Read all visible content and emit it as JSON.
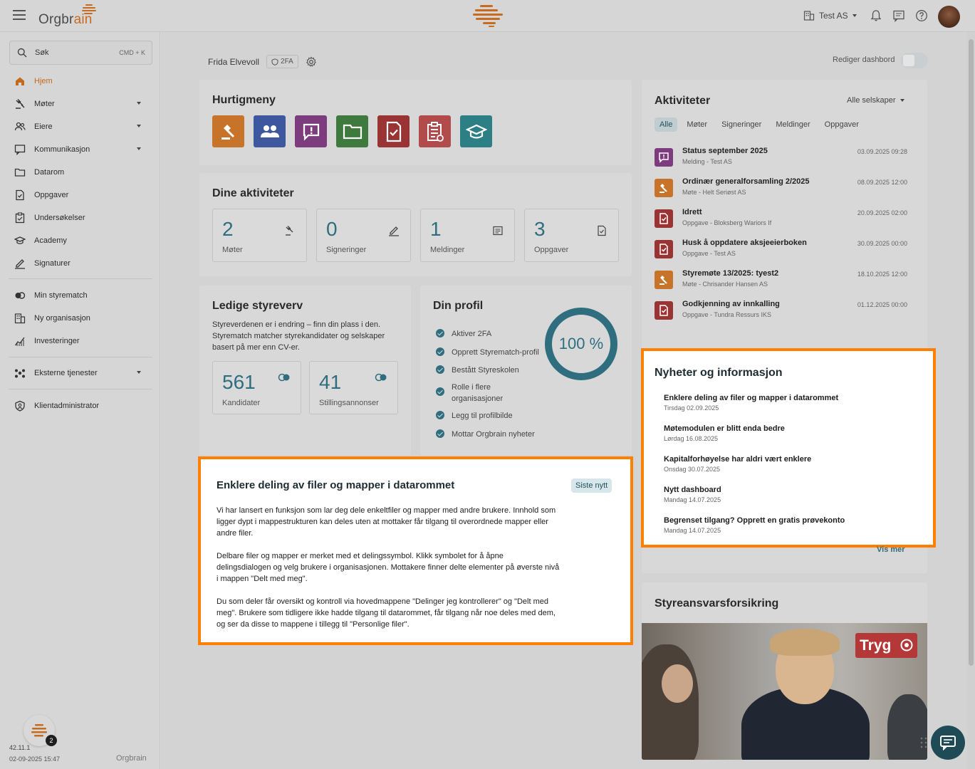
{
  "topbar": {
    "logo_text_a": "Orgbr",
    "logo_text_b": "ain",
    "company": "Test AS"
  },
  "sidebar": {
    "search_label": "Søk",
    "search_shortcut": "CMD + K",
    "items": [
      {
        "label": "Hjem",
        "icon": "home-icon",
        "active": true
      },
      {
        "label": "Møter",
        "icon": "gavel-icon"
      },
      {
        "label": "Eiere",
        "icon": "users-icon"
      },
      {
        "label": "Kommunikasjon",
        "icon": "message-icon"
      },
      {
        "label": "Datarom",
        "icon": "folder-icon"
      },
      {
        "label": "Oppgaver",
        "icon": "task-icon"
      },
      {
        "label": "Undersøkelser",
        "icon": "survey-icon"
      },
      {
        "label": "Academy",
        "icon": "graduation-icon"
      },
      {
        "label": "Signaturer",
        "icon": "signature-icon"
      },
      {
        "label": "Min styrematch",
        "icon": "match-icon"
      },
      {
        "label": "Ny organisasjon",
        "icon": "building-icon"
      },
      {
        "label": "Investeringer",
        "icon": "chart-icon"
      },
      {
        "label": "Eksterne tjenester",
        "icon": "network-icon"
      },
      {
        "label": "Klientadministrator",
        "icon": "admin-icon"
      }
    ],
    "notification_count": "2",
    "version": "42.11.1",
    "version_date": "02-09-2025 15:47",
    "footer_logo": "Orgbrain"
  },
  "header": {
    "user_name": "Frida Elvevoll",
    "twofa": "2FA",
    "edit_dashboard": "Rediger dashbord"
  },
  "quickmenu": {
    "title": "Hurtigmeny",
    "colors": [
      "#c8732a",
      "#3e58a0",
      "#7d3c7e",
      "#3e7a3d",
      "#9a3333",
      "#b24b4b",
      "#2c7f84"
    ]
  },
  "my_activities": {
    "title": "Dine aktiviteter",
    "stats": [
      {
        "value": "2",
        "label": "Møter"
      },
      {
        "value": "0",
        "label": "Signeringer"
      },
      {
        "value": "1",
        "label": "Meldinger"
      },
      {
        "value": "3",
        "label": "Oppgaver"
      }
    ]
  },
  "board": {
    "title": "Ledige styreverv",
    "text": "Styreverdenen er i endring – finn din plass i den. Styrematch matcher styrekandidater og selskaper basert på mer enn CV-er.",
    "stats": [
      {
        "value": "561",
        "label": "Kandidater"
      },
      {
        "value": "41",
        "label": "Stillingsannonser"
      }
    ]
  },
  "profile": {
    "title": "Din profil",
    "percent": "100 %",
    "items": [
      "Aktiver 2FA",
      "Opprett Styrematch-profil",
      "Bestått Styreskolen",
      "Rolle i flere organisasjoner",
      "Legg til profilbilde",
      "Mottar Orgbrain nyheter"
    ]
  },
  "activities": {
    "title": "Aktiviteter",
    "filter": "Alle selskaper",
    "tabs": [
      "Alle",
      "Møter",
      "Signeringer",
      "Meldinger",
      "Oppgaver"
    ],
    "items": [
      {
        "title": "Status september 2025",
        "sub": "Melding - Test AS",
        "date": "03.09.2025 09:28",
        "color": "#7d3c7e"
      },
      {
        "title": "Ordinær generalforsamling 2/2025",
        "sub": "Møte - Helt Seriøst AS",
        "date": "08.09.2025 12:00",
        "color": "#c8732a"
      },
      {
        "title": "Idrett",
        "sub": "Oppgave - Bloksberg Wariors If",
        "date": "20.09.2025 02:00",
        "color": "#9a3333"
      },
      {
        "title": "Husk å oppdatere aksjeeierboken",
        "sub": "Oppgave - Test AS",
        "date": "30.09.2025 00:00",
        "color": "#9a3333"
      },
      {
        "title": "Styremøte 13/2025: tyest2",
        "sub": "Møte - Chrisander Hansen AS",
        "date": "18.10.2025 12:00",
        "color": "#c8732a"
      },
      {
        "title": "Godkjenning av innkalling",
        "sub": "Oppgave - Tundra Ressurs IKS",
        "date": "01.12.2025 00:00",
        "color": "#9a3333"
      }
    ]
  },
  "news": {
    "title": "Nyheter og informasjon",
    "items": [
      {
        "title": "Enklere deling av filer og mapper i datarommet",
        "date": "Tirsdag 02.09.2025"
      },
      {
        "title": "Møtemodulen er blitt enda bedre",
        "date": "Lørdag 16.08.2025"
      },
      {
        "title": "Kapitalforhøyelse har aldri vært enklere",
        "date": "Onsdag 30.07.2025"
      },
      {
        "title": "Nytt dashboard",
        "date": "Mandag 14.07.2025"
      },
      {
        "title": "Begrenset tilgang? Opprett en gratis prøvekonto",
        "date": "Mandag 14.07.2025"
      }
    ],
    "more": "Vis mer"
  },
  "article": {
    "title": "Enklere deling av filer og mapper i datarommet",
    "badge": "Siste nytt",
    "paragraphs": [
      "Vi har lansert en funksjon som lar deg dele enkeltfiler og mapper med andre brukere. Innhold som ligger dypt i mappestrukturen kan deles uten at mottaker får tilgang til overordnede mapper eller andre filer.",
      "Delbare filer og mapper er merket med et delingssymbol. Klikk symbolet for å åpne delingsdialogen og velg brukere i organisasjonen. Mottakere finner delte elementer på øverste nivå i mappen \"Delt med meg\".",
      "Du som deler får oversikt og kontroll via hovedmappene \"Delinger jeg kontrollerer\" og \"Delt med meg\". Brukere som tidligere ikke hadde tilgang til datarommet, får tilgang når noe deles med dem, og ser da disse to mappene i tillegg til \"Personlige filer\"."
    ]
  },
  "insurance": {
    "title": "Styreansvarsforsikring",
    "brand": "Tryg"
  },
  "colors": {
    "accent": "#ff7f00",
    "teal": "#2f6e7f",
    "brand_orange": "#c66b1f"
  }
}
